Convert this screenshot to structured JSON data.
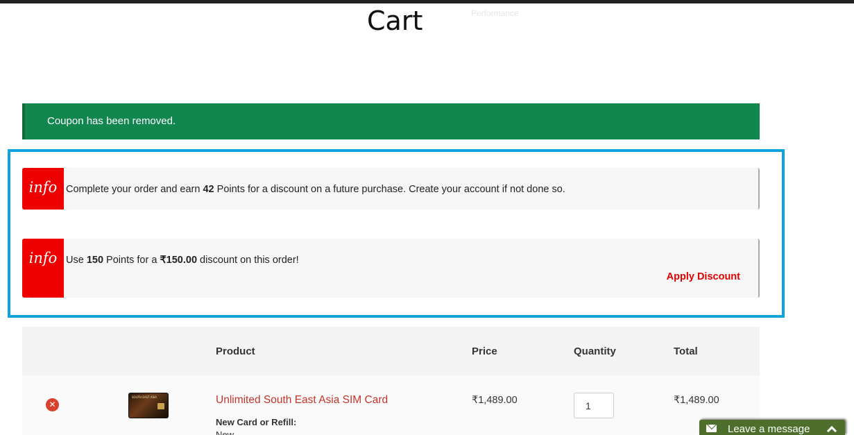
{
  "page": {
    "title": "Cart",
    "faint_label": "Performance"
  },
  "success_banner": {
    "message": "Coupon has been removed."
  },
  "notices": [
    {
      "badge": "info",
      "text_before": "Complete your order and earn ",
      "points": "42",
      "text_after": " Points for a discount on a future purchase. Create your account if not done so."
    },
    {
      "badge": "info",
      "text_before": "Use ",
      "points": "150",
      "text_middle": " Points for a ",
      "amount": "₹150.00",
      "text_after": " discount on this order!",
      "action_label": "Apply Discount"
    }
  ],
  "cart": {
    "columns": [
      "Product",
      "Price",
      "Quantity",
      "Total"
    ],
    "rows": [
      {
        "product_name": "Unlimited South East Asia SIM Card",
        "thumbnail_caption": "SOUTH EAST ASIA",
        "meta_label": "New Card or Refill:",
        "meta_value": "New",
        "price": "₹1,489.00",
        "quantity": "1",
        "total": "₹1,489.00"
      }
    ]
  },
  "chat": {
    "label": "Leave a message"
  },
  "colors": {
    "success": "#12864f",
    "info_badge": "#ee0000",
    "highlight_border": "#11a3dd",
    "link": "#c4342b",
    "chat": "#4d6f2b"
  }
}
